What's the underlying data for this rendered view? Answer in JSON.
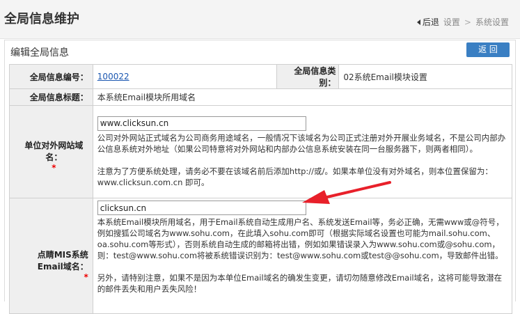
{
  "header": {
    "title": "全局信息维护",
    "back_label": "后退",
    "crumb_settings": "设置",
    "crumb_sep": ">",
    "crumb_system": "系统设置"
  },
  "panel": {
    "title": "编辑全局信息",
    "back_button": "返 回"
  },
  "row1": {
    "id_label": "全局信息编号：",
    "id_value": "100022",
    "category_label": "全局信息类别：",
    "category_value": "02系统Email模块设置"
  },
  "row2": {
    "title_label": "全局信息标题：",
    "title_value": "本系统Email模块所用域名"
  },
  "row3": {
    "label": "单位对外网站域名：",
    "required_mark": "*",
    "input_value": "www.clicksun.cn",
    "desc1": "公司对外网站正式域名为公司商务用途域名，一般情况下该域名为公司正式注册对外开展业务域名，不是公司内部办公信息系统对外地址（如果公司特意将对外网站和内部办公信息系统安装在同一台服务器下，则两者相同）。",
    "desc2": "注意为了方便系统处理，请务必不要在该域名前后添加http://或/。如果本单位没有对外域名，则本位置保留为：www.clicksun.com.cn 即可。"
  },
  "row4": {
    "label_line1": "点睛MIS系统",
    "label_line2": "Email域名：",
    "required_mark": "*",
    "input_value": "clicksun.cn",
    "desc1": "本系统Email模块所用域名，用于Email系统自动生成用户名、系统发送Email等，务必正确，无需www或@符号，例如搜狐公司域名为www.sohu.com，在此填入sohu.com即可（根据实际域名设置也可能为mail.sohu.com、oa.sohu.com等形式），否则系统自动生成的邮箱将出错，例如如果错误录入为www.sohu.com或@sohu.com，则：test@www.sohu.com将被系统错误识别为：test@www.sohu.com或test@@sohu.com，导致邮件出错。",
    "desc2": "另外，请特别注意，如果不是因为本单位Email域名的确发生变更，请切勿随意修改Email域名，这将可能导致潜在的邮件丢失和用户丢失风险！"
  },
  "colors": {
    "button": "#3a7fc3",
    "label_bg": "#efefef",
    "required": "#e00000",
    "annotation_arrow": "#e8202a"
  }
}
